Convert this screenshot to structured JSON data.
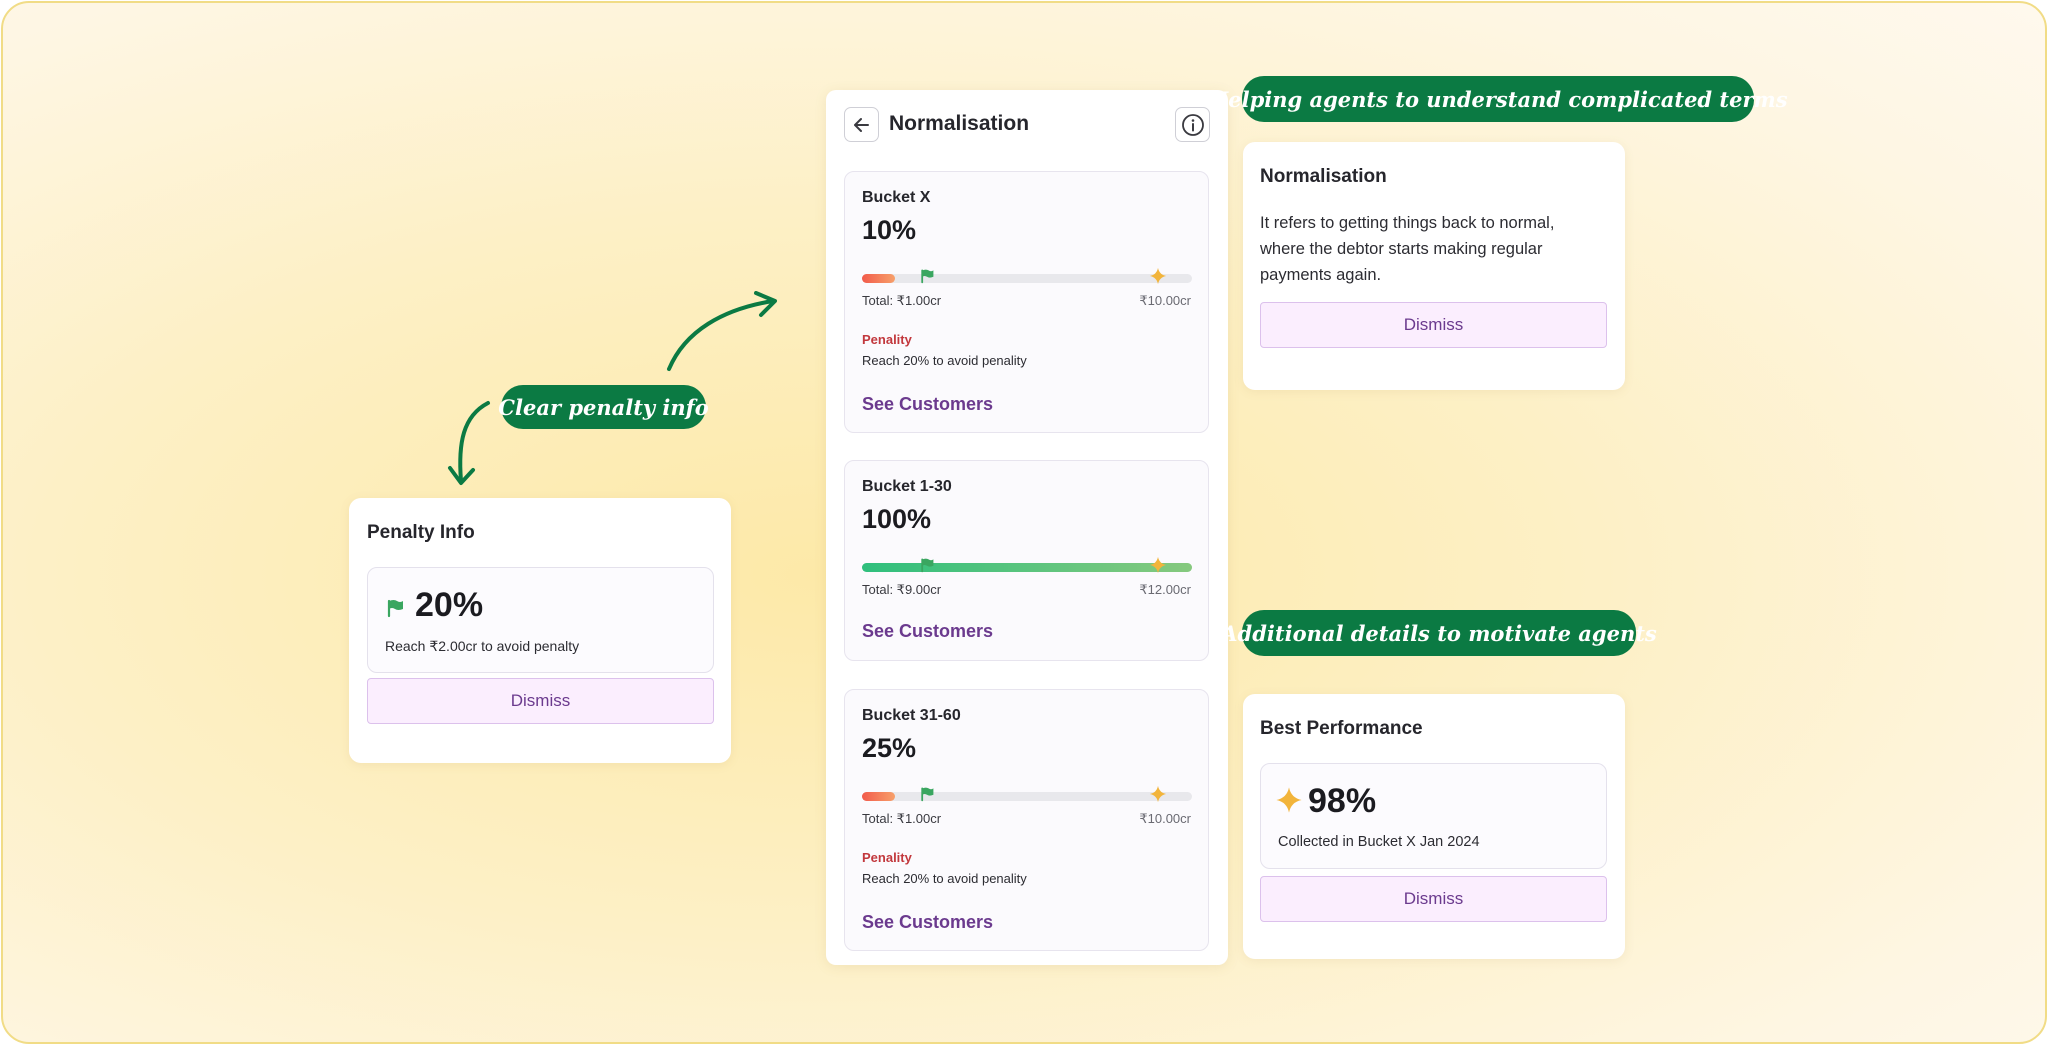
{
  "colors": {
    "accent_green": "#0b7a43",
    "penalty_red": "#c2383d",
    "link_purple": "#6b3a8e",
    "dismiss_bg": "#fbeefe",
    "star_gold": "#f2b43b",
    "flag_green": "#3aa660"
  },
  "callouts": {
    "penalty": "Clear penalty info",
    "terms": "Helping agents to understand complicated terms",
    "motivate": "Additional details to motivate agents"
  },
  "penalty_card": {
    "title": "Penalty Info",
    "icon": "flag-icon",
    "value": "20%",
    "description": "Reach ₹2.00cr to avoid penalty",
    "dismiss_label": "Dismiss"
  },
  "panel": {
    "title": "Normalisation",
    "back_icon": "arrow-left-icon",
    "info_icon": "info-icon",
    "buckets": [
      {
        "name": "Bucket X",
        "percent": "10%",
        "progress": 0.1,
        "status": "behind",
        "total": "Total: ₹1.00cr",
        "target": "₹10.00cr",
        "penalty_label": "Penality",
        "penalty_text": "Reach 20% to avoid penality",
        "link": "See Customers"
      },
      {
        "name": "Bucket 1-30",
        "percent": "100%",
        "progress": 1.0,
        "status": "complete",
        "total": "Total: ₹9.00cr",
        "target": "₹12.00cr",
        "link": "See Customers"
      },
      {
        "name": "Bucket 31-60",
        "percent": "25%",
        "progress": 0.1,
        "status": "behind",
        "total": "Total: ₹1.00cr",
        "target": "₹10.00cr",
        "penalty_label": "Penality",
        "penalty_text": "Reach 20% to avoid penality",
        "link": "See Customers"
      }
    ]
  },
  "definition_card": {
    "title": "Normalisation",
    "text": "It refers to getting things back to normal, where the debtor starts making regular payments again.",
    "dismiss_label": "Dismiss"
  },
  "best_card": {
    "title": "Best Performance",
    "icon": "sparkle-icon",
    "value": "98%",
    "description": "Collected in Bucket X Jan 2024",
    "dismiss_label": "Dismiss"
  }
}
